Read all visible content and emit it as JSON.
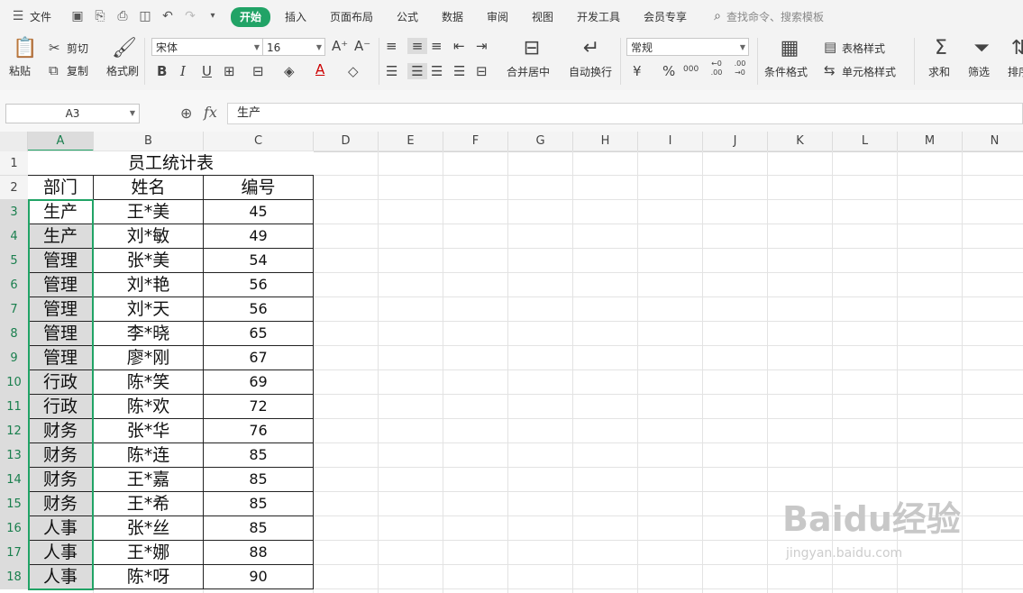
{
  "menu": {
    "file_label": "文件",
    "tabs": [
      {
        "label": "开始",
        "active": true
      },
      {
        "label": "插入"
      },
      {
        "label": "页面布局"
      },
      {
        "label": "公式"
      },
      {
        "label": "数据"
      },
      {
        "label": "审阅"
      },
      {
        "label": "视图"
      },
      {
        "label": "开发工具"
      },
      {
        "label": "会员专享"
      }
    ],
    "search_placeholder": "查找命令、搜索模板"
  },
  "ribbon": {
    "paste": "粘贴",
    "cut": "剪切",
    "copy": "复制",
    "format_painter": "格式刷",
    "font_name": "宋体",
    "font_size": "16",
    "merge_center": "合并居中",
    "wrap_text": "自动换行",
    "number_format": "常规",
    "conditional_format": "条件格式",
    "table_style": "表格样式",
    "cell_style": "单元格样式",
    "sum": "求和",
    "filter": "筛选",
    "sort": "排序",
    "font_bold": "B",
    "font_italic": "I",
    "font_underline": "U",
    "currency": "¥",
    "percent": "%",
    "thousands": "000",
    "dec_increase": "←0 .00",
    "dec_decrease": ".00 →0"
  },
  "formula_bar": {
    "name_box": "A3",
    "fx_label": "fx",
    "content": "生产"
  },
  "columns": [
    "A",
    "B",
    "C",
    "D",
    "E",
    "F",
    "G",
    "H",
    "I",
    "J",
    "K",
    "L",
    "M",
    "N"
  ],
  "rows": [
    "1",
    "2",
    "3",
    "4",
    "5",
    "6",
    "7",
    "8",
    "9",
    "10",
    "11",
    "12",
    "13",
    "14",
    "15",
    "16",
    "17",
    "18"
  ],
  "sheet": {
    "title": "员工统计表",
    "headers": [
      "部门",
      "姓名",
      "编号"
    ],
    "records": [
      [
        "生产",
        "王*美",
        "45"
      ],
      [
        "生产",
        "刘*敏",
        "49"
      ],
      [
        "管理",
        "张*美",
        "54"
      ],
      [
        "管理",
        "刘*艳",
        "56"
      ],
      [
        "管理",
        "刘*天",
        "56"
      ],
      [
        "管理",
        "李*晓",
        "65"
      ],
      [
        "管理",
        "廖*刚",
        "67"
      ],
      [
        "行政",
        "陈*笑",
        "69"
      ],
      [
        "行政",
        "陈*欢",
        "72"
      ],
      [
        "财务",
        "张*华",
        "76"
      ],
      [
        "财务",
        "陈*连",
        "85"
      ],
      [
        "财务",
        "王*嘉",
        "85"
      ],
      [
        "财务",
        "王*希",
        "85"
      ],
      [
        "人事",
        "张*丝",
        "85"
      ],
      [
        "人事",
        "王*娜",
        "88"
      ],
      [
        "人事",
        "陈*呀",
        "90"
      ]
    ]
  },
  "watermark": {
    "main": "Baidu经验",
    "sub": "jingyan.baidu.com"
  },
  "colors": {
    "accent": "#21a366",
    "selection_fill": "#dcdcdc"
  }
}
